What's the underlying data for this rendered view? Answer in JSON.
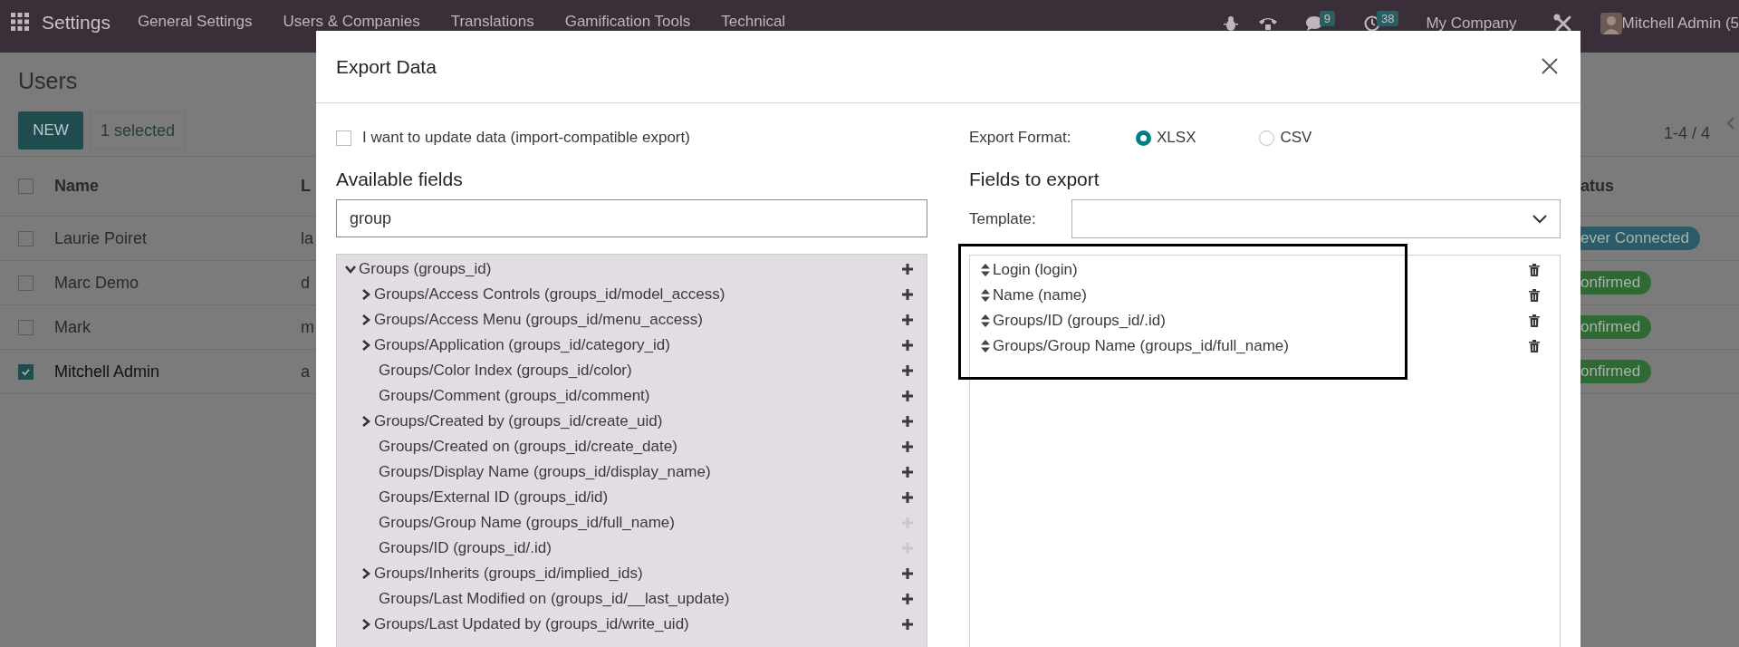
{
  "navbar": {
    "app_title": "Settings",
    "menu": [
      "General Settings",
      "Users & Companies",
      "Translations",
      "Gamification Tools",
      "Technical"
    ],
    "chat_count": "9",
    "activity_count": "38",
    "company": "My Company",
    "user": "Mitchell Admin (5"
  },
  "users_view": {
    "title": "Users",
    "new_button": "NEW",
    "selection": "1 selected",
    "pager": "1-4 / 4",
    "header_checked": false,
    "columns": [
      "Name",
      "L",
      "atus"
    ],
    "rows": [
      {
        "name": "Laurie Poiret",
        "column_2": "la",
        "status": "ever Connected",
        "color": "#2b5b68",
        "selected": false
      },
      {
        "name": "Marc Demo",
        "column_2": "d",
        "status": "onfirmed",
        "color": "#2f6a35",
        "selected": false
      },
      {
        "name": "Mark",
        "column_2": "m",
        "status": "onfirmed",
        "color": "#2f6a35",
        "selected": false
      },
      {
        "name": "Mitchell Admin",
        "column_2": "a",
        "status": "onfirmed",
        "color": "#2f6a35",
        "selected": true
      }
    ]
  },
  "export_dialog": {
    "title": "Export Data",
    "import_compatible": {
      "label": "I want to update data (import-compatible export)",
      "checked": false
    },
    "available_fields": {
      "heading": "Available fields",
      "search": "group",
      "tree": [
        {
          "label": "Groups (groups_id)",
          "kind": "relation",
          "expanded": true,
          "addable": true,
          "children": [
            {
              "label": "Groups/Access Controls (groups_id/model_access)",
              "kind": "relation",
              "expanded": false,
              "addable": true
            },
            {
              "label": "Groups/Access Menu (groups_id/menu_access)",
              "kind": "relation",
              "expanded": false,
              "addable": true
            },
            {
              "label": "Groups/Application (groups_id/category_id)",
              "kind": "relation",
              "expanded": false,
              "addable": true
            },
            {
              "label": "Groups/Color Index (groups_id/color)",
              "kind": "field",
              "addable": true
            },
            {
              "label": "Groups/Comment (groups_id/comment)",
              "kind": "field",
              "addable": true
            },
            {
              "label": "Groups/Created by (groups_id/create_uid)",
              "kind": "relation",
              "expanded": false,
              "addable": true
            },
            {
              "label": "Groups/Created on (groups_id/create_date)",
              "kind": "field",
              "addable": true
            },
            {
              "label": "Groups/Display Name (groups_id/display_name)",
              "kind": "field",
              "addable": true
            },
            {
              "label": "Groups/External ID (groups_id/id)",
              "kind": "field",
              "addable": true
            },
            {
              "label": "Groups/Group Name (groups_id/full_name)",
              "kind": "field",
              "addable": false
            },
            {
              "label": "Groups/ID (groups_id/.id)",
              "kind": "field",
              "addable": false
            },
            {
              "label": "Groups/Inherits (groups_id/implied_ids)",
              "kind": "relation",
              "expanded": false,
              "addable": true
            },
            {
              "label": "Groups/Last Modified on (groups_id/__last_update)",
              "kind": "field",
              "addable": true
            },
            {
              "label": "Groups/Last Updated by (groups_id/write_uid)",
              "kind": "relation",
              "expanded": false,
              "addable": true
            }
          ]
        }
      ]
    },
    "export_format": {
      "label": "Export Format:",
      "options": [
        {
          "label": "XLSX",
          "selected": true
        },
        {
          "label": "CSV",
          "selected": false
        }
      ]
    },
    "fields_to_export": {
      "heading": "Fields to export",
      "template_label": "Template:",
      "fields": [
        "Login (login)",
        "Name (name)",
        "Groups/ID (groups_id/.id)",
        "Groups/Group Name (groups_id/full_name)"
      ]
    }
  }
}
